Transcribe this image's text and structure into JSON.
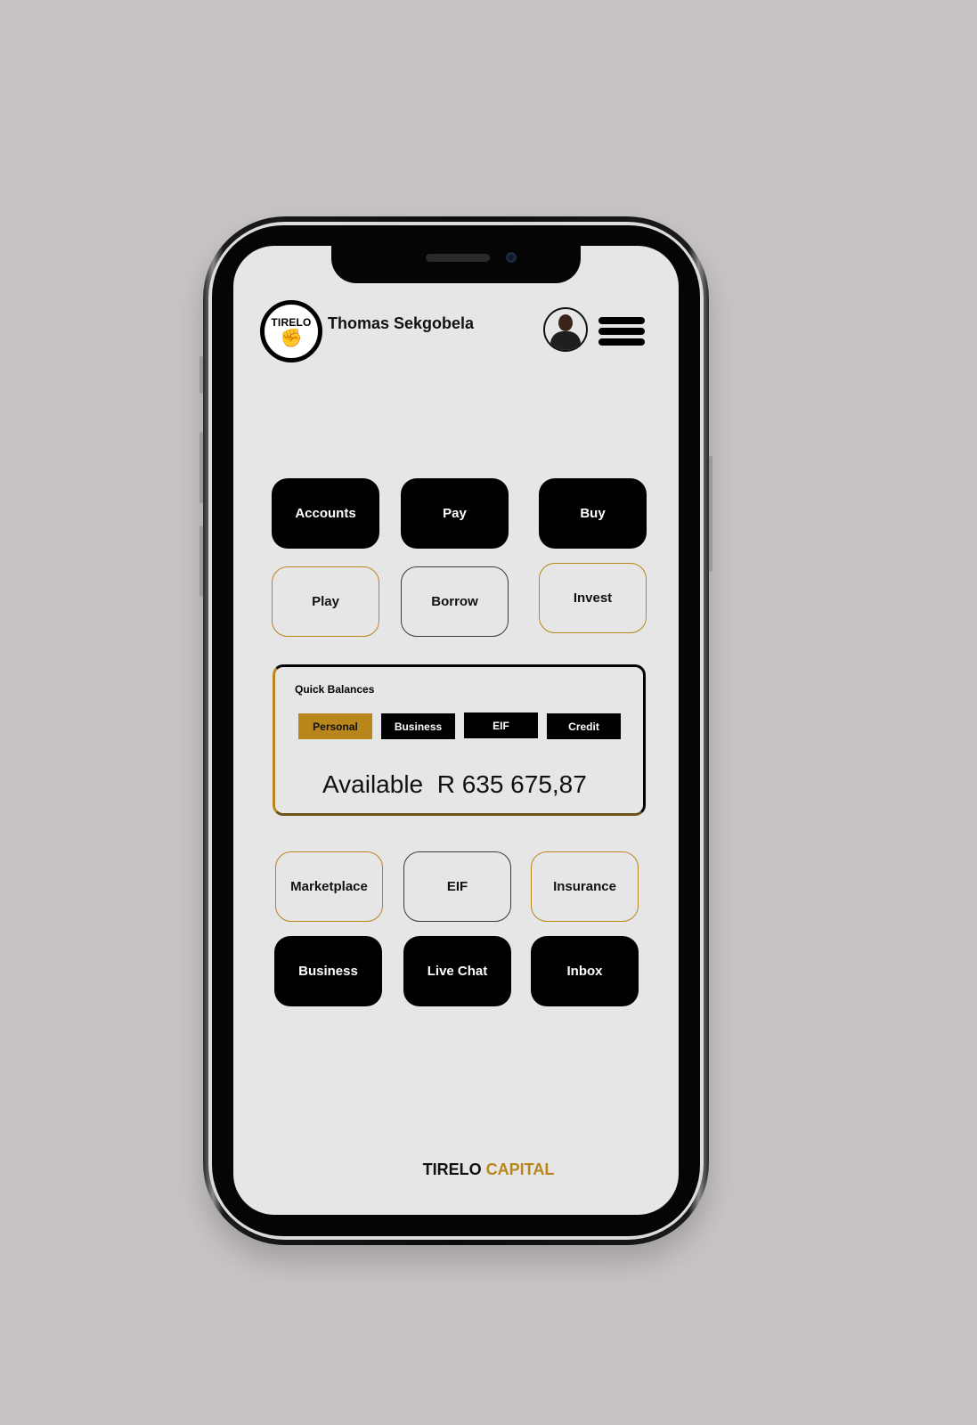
{
  "header": {
    "logo_text": "TIRELO",
    "user_name": "Thomas Sekgobela"
  },
  "top_tiles": [
    {
      "label": "Accounts"
    },
    {
      "label": "Pay"
    },
    {
      "label": "Buy"
    },
    {
      "label": "Play"
    },
    {
      "label": "Borrow"
    },
    {
      "label": "Invest"
    }
  ],
  "quick_balances": {
    "title": "Quick Balances",
    "tabs": [
      {
        "label": "Personal",
        "active": true
      },
      {
        "label": "Business"
      },
      {
        "label": "EIF"
      },
      {
        "label": "Credit"
      }
    ],
    "available_label": "Available",
    "available_value": "R 635 675,87"
  },
  "bottom_tiles": [
    {
      "label": "Marketplace"
    },
    {
      "label": "EIF"
    },
    {
      "label": "Insurance"
    },
    {
      "label": "Business"
    },
    {
      "label": "Live Chat"
    },
    {
      "label": "Inbox"
    }
  ],
  "footer": {
    "brand_part1": "TIRELO",
    "brand_part2": "CAPITAL"
  },
  "colors": {
    "accent_gold": "#b8861b",
    "screen_bg": "#e6e6e6",
    "page_bg": "#c6c3c2"
  }
}
